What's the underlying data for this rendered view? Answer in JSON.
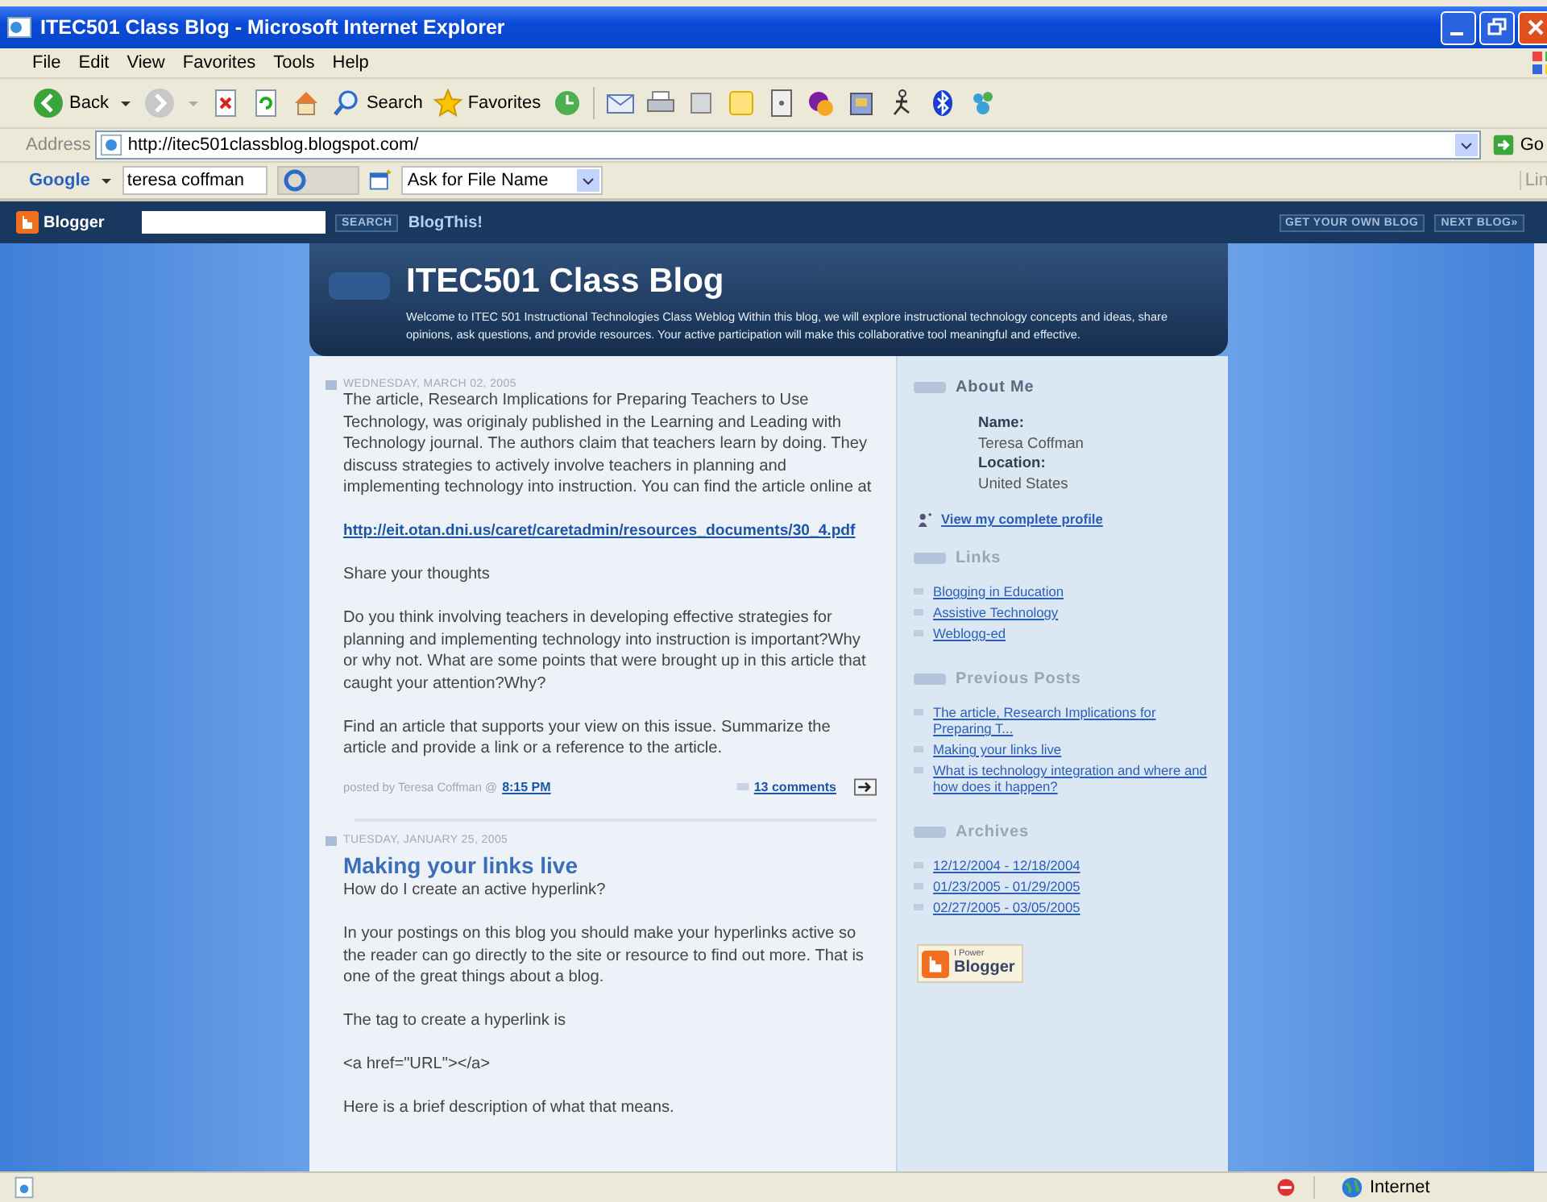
{
  "window": {
    "title": "ITEC501 Class Blog - Microsoft Internet Explorer"
  },
  "menu": [
    "File",
    "Edit",
    "View",
    "Favorites",
    "Tools",
    "Help"
  ],
  "toolbar": {
    "back": "Back",
    "search": "Search",
    "favorites": "Favorites"
  },
  "address_bar": {
    "label": "Address",
    "url": "http://itec501classblog.blogspot.com/",
    "go": "Go"
  },
  "google_bar": {
    "logo": "Google",
    "search_value": "teresa coffman",
    "dropdown": "Ask for File Name",
    "links": "Lin"
  },
  "blogger_bar": {
    "logo": "Blogger",
    "search_button": "SEARCH",
    "blog_this": "BlogThis!",
    "get_own_blog": "GET YOUR OWN BLOG",
    "next_blog": "NEXT BLOG»"
  },
  "blog": {
    "title": "ITEC501 Class Blog",
    "description": "Welcome to ITEC 501 Instructional Technologies Class Weblog Within this blog, we will explore instructional technology concepts and ideas, share opinions, ask questions, and provide resources. Your active participation will make this collaborative tool meaningful and effective."
  },
  "posts": [
    {
      "date": "WEDNESDAY, MARCH 02, 2005",
      "paragraphs": [
        {
          "kind": "text",
          "text": "The article, Research Implications for Preparing Teachers to Use Technology, was originaly published in the Learning and Leading with Technology journal. The authors claim that teachers learn by doing. They discuss strategies to actively involve teachers in planning and implementing technology into instruction. You can find the article online at"
        },
        {
          "kind": "link",
          "text": "http://eit.otan.dni.us/caret/caretadmin/resources_documents/30_4.pdf"
        },
        {
          "kind": "text",
          "text": "Share your thoughts"
        },
        {
          "kind": "text",
          "text": "Do you think involving teachers in developing effective strategies for planning and implementing technology into instruction is important?Why or why not. What are some points that were brought up in this article that caught your attention?Why?"
        },
        {
          "kind": "text",
          "text": "Find an article that supports your view on this issue. Summarize the article and provide a link or a reference to the article."
        }
      ],
      "footer": {
        "posted_by": "posted by Teresa Coffman @",
        "time": "8:15 PM",
        "comments": "13 comments"
      }
    },
    {
      "date": "TUESDAY, JANUARY 25, 2005",
      "title": "Making your links live",
      "paragraphs": [
        {
          "kind": "tight",
          "text": "How do I create an active hyperlink?"
        },
        {
          "kind": "text",
          "text": "In your postings on this blog you should make your hyperlinks active so the reader can go directly to the site or resource to find out more. That is one of the great things about a blog."
        },
        {
          "kind": "text",
          "text": "The tag to create a hyperlink is"
        },
        {
          "kind": "text",
          "text": "<a href=\"URL\"></a>"
        },
        {
          "kind": "text",
          "text": "Here is a brief description of what that means."
        }
      ]
    }
  ],
  "sidebar": {
    "about_me": {
      "heading": "About Me",
      "fields": [
        {
          "label": "Name:",
          "value": "Teresa Coffman"
        },
        {
          "label": "Location:",
          "value": "United States"
        }
      ],
      "profile_link": "View my complete profile"
    },
    "sections": [
      {
        "heading": "Links",
        "links": [
          "Blogging in Education",
          "Assistive Technology",
          "Weblogg-ed"
        ]
      },
      {
        "heading": "Previous Posts",
        "links": [
          "The article, Research Implications for Preparing T...",
          "Making your links live",
          "What is technology integration and where and how does it happen?"
        ]
      },
      {
        "heading": "Archives",
        "links": [
          "12/12/2004 - 12/18/2004",
          "01/23/2005 - 01/29/2005",
          "02/27/2005 - 03/05/2005"
        ]
      }
    ],
    "badge": {
      "small": "I Power",
      "big": "Blogger"
    }
  },
  "status_bar": {
    "zone": "Internet"
  }
}
